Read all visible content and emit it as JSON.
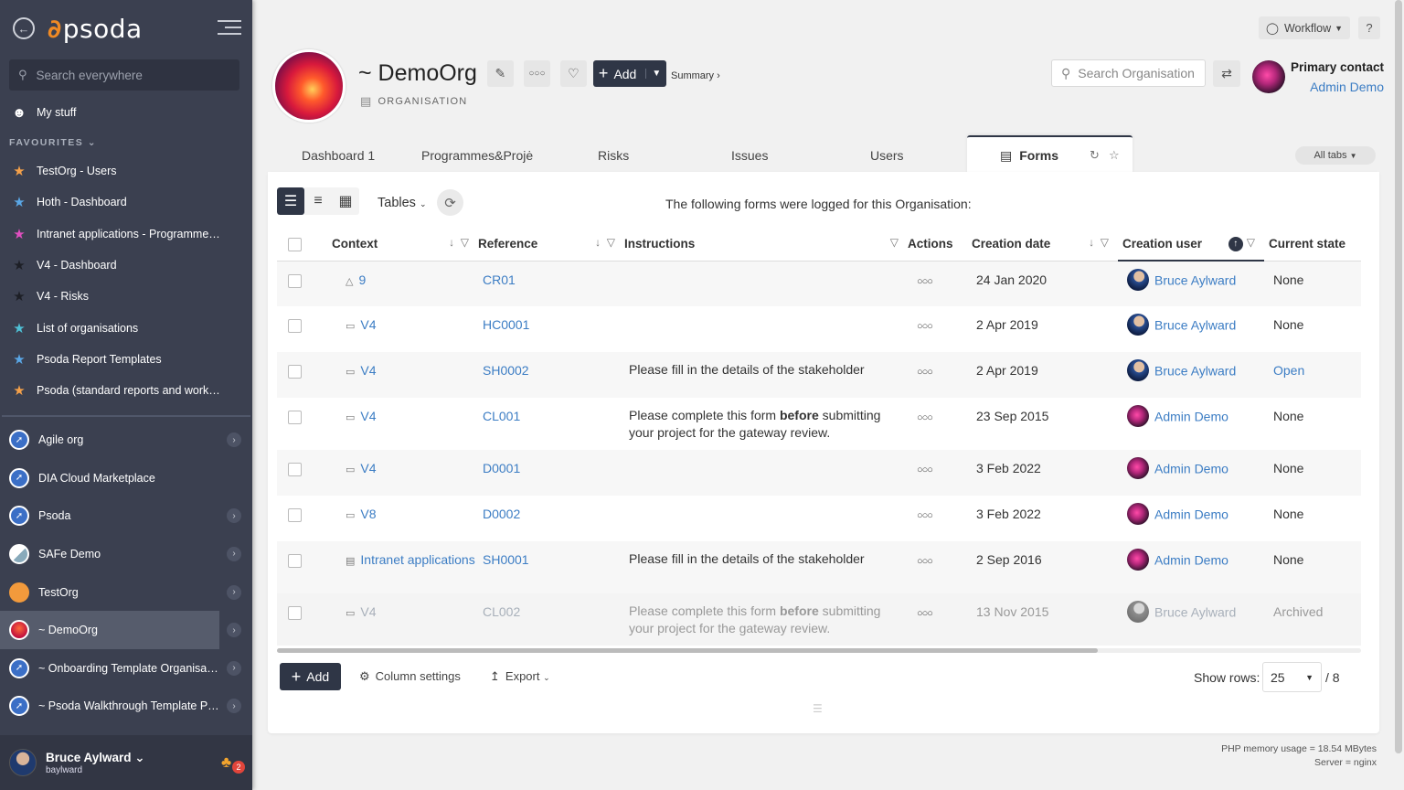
{
  "sidebar": {
    "logo": "psoda",
    "search_placeholder": "Search everywhere",
    "my_stuff": "My stuff",
    "favourites_label": "FAVOURITES",
    "favourites": [
      {
        "label": "TestOrg - Users",
        "star": "orange"
      },
      {
        "label": "Hoth - Dashboard",
        "star": "blue"
      },
      {
        "label": "Intranet applications - Programme…",
        "star": "pink"
      },
      {
        "label": "V4 - Dashboard",
        "star": "dark"
      },
      {
        "label": "V4 - Risks",
        "star": "dark"
      },
      {
        "label": "List of organisations",
        "star": "cyan"
      },
      {
        "label": "Psoda Report Templates",
        "star": "blue"
      },
      {
        "label": "Psoda (standard reports and work…",
        "star": "orange"
      }
    ],
    "orgs": [
      {
        "label": "Agile org",
        "chevron": true
      },
      {
        "label": "DIA Cloud Marketplace",
        "chevron": false
      },
      {
        "label": "Psoda",
        "chevron": true
      },
      {
        "label": "SAFe Demo",
        "chevron": true
      },
      {
        "label": "TestOrg",
        "chevron": true
      },
      {
        "label": "~ DemoOrg",
        "chevron": true,
        "active": true
      },
      {
        "label": "~ Onboarding Template Organisa…",
        "chevron": true
      },
      {
        "label": "~ Psoda Walkthrough Template P…",
        "chevron": true
      }
    ],
    "user": {
      "name": "Bruce Aylward",
      "login": "baylward",
      "notifications": "2"
    }
  },
  "header": {
    "title": "~ DemoOrg",
    "subtitle": "ORGANISATION",
    "add_label": "Add",
    "summary_link": "Summary ›",
    "workflow_label": "Workflow",
    "help_label": "?",
    "search_placeholder": "Search Organisation",
    "primary_contact_label": "Primary contact",
    "primary_contact_name": "Admin Demo"
  },
  "tabs": [
    {
      "label": "Dashboard 1"
    },
    {
      "label": "Programmes&Projė"
    },
    {
      "label": "Risks"
    },
    {
      "label": "Issues"
    },
    {
      "label": "Users"
    }
  ],
  "active_tab": "Forms",
  "all_tabs_label": "All tabs",
  "toolbar": {
    "tables_label": "Tables",
    "caption": "The following forms were logged for this Organisation:"
  },
  "table": {
    "headers": {
      "context": "Context",
      "reference": "Reference",
      "instructions": "Instructions",
      "actions": "Actions",
      "creation_date": "Creation date",
      "creation_user": "Creation user",
      "current_state": "Current state"
    },
    "rows": [
      {
        "context": "9",
        "ctx_icon": "org-chart-icon",
        "reference": "CR01",
        "instructions": "",
        "bold": "",
        "instructions_after": "",
        "date": "24 Jan 2020",
        "user": "Bruce Aylward",
        "avatar": "bruce",
        "state": "None"
      },
      {
        "context": "V4",
        "ctx_icon": "project-icon",
        "reference": "HC0001",
        "instructions": "",
        "bold": "",
        "instructions_after": "",
        "date": "2 Apr 2019",
        "user": "Bruce Aylward",
        "avatar": "bruce",
        "state": "None"
      },
      {
        "context": "V4",
        "ctx_icon": "project-icon",
        "reference": "SH0002",
        "instructions": "Please fill in the details of the stakeholder",
        "bold": "",
        "instructions_after": "",
        "date": "2 Apr 2019",
        "user": "Bruce Aylward",
        "avatar": "bruce",
        "state": "Open"
      },
      {
        "context": "V4",
        "ctx_icon": "project-icon",
        "reference": "CL001",
        "instructions": "Please complete this form ",
        "bold": "before",
        "instructions_after": " submitting your project for the gateway review.",
        "date": "23 Sep 2015",
        "user": "Admin Demo",
        "avatar": "admin",
        "state": "None"
      },
      {
        "context": "V4",
        "ctx_icon": "project-icon",
        "reference": "D0001",
        "instructions": "",
        "bold": "",
        "instructions_after": "",
        "date": "3 Feb 2022",
        "user": "Admin Demo",
        "avatar": "admin",
        "state": "None"
      },
      {
        "context": "V8",
        "ctx_icon": "project-icon",
        "reference": "D0002",
        "instructions": "",
        "bold": "",
        "instructions_after": "",
        "date": "3 Feb 2022",
        "user": "Admin Demo",
        "avatar": "admin",
        "state": "None"
      },
      {
        "context": "Intranet applications",
        "ctx_icon": "programme-icon",
        "reference": "SH0001",
        "instructions": "Please fill in the details of the stakeholder",
        "bold": "",
        "instructions_after": "",
        "date": "2 Sep 2016",
        "user": "Admin Demo",
        "avatar": "admin",
        "state": "None"
      },
      {
        "context": "V4",
        "ctx_icon": "project-icon",
        "reference": "CL002",
        "instructions": "Please complete this form ",
        "bold": "before",
        "instructions_after": " submitting your project for the gateway review.",
        "date": "13 Nov 2015",
        "user": "Bruce Aylward",
        "avatar": "bruce",
        "state": "Archived",
        "archived": true
      }
    ]
  },
  "footer": {
    "add_label": "Add",
    "column_settings_label": "Column settings",
    "export_label": "Export",
    "show_rows_label": "Show rows:",
    "rows_value": "25",
    "total": "/ 8"
  },
  "sysinfo": {
    "memory": "PHP memory usage = 18.54 MBytes",
    "server": "Server = nginx"
  }
}
